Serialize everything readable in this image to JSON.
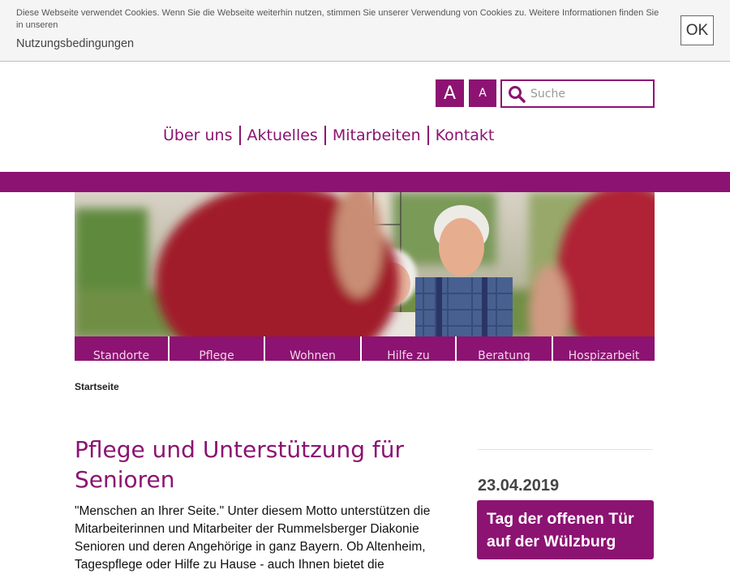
{
  "cookie_bar": {
    "text": "Diese Webseite verwendet Cookies. Wenn Sie die Webseite weiterhin nutzen, stimmen Sie unserer Verwendung von Cookies zu. Weitere Informationen finden Sie in unseren",
    "link": "Nutzungsbedingungen",
    "ok_label": "OK"
  },
  "font_size": {
    "large_label": "A",
    "small_label": "A"
  },
  "search": {
    "placeholder": "Suche",
    "value": ""
  },
  "top_nav": [
    "Über uns",
    "Aktuelles",
    "Mitarbeiten",
    "Kontakt"
  ],
  "category_tabs": [
    "Standorte",
    "Pflege",
    "Wohnen",
    "Hilfe zu",
    "Beratung",
    "Hospizarbeit"
  ],
  "breadcrumb": "Startseite",
  "main": {
    "title": "Pflege und Unterstützung für Senioren",
    "intro": "\"Menschen an Ihrer Seite.\" Unter diesem Motto unterstützen die Mitarbeiterinnen und Mitarbeiter der Rummelsberger Diakonie Senioren und deren Angehörige in ganz Bayern. Ob Altenheim, Tagespflege oder Hilfe zu Hause - auch Ihnen bietet die"
  },
  "sidebar": {
    "event_date": "23.04.2019",
    "event_title": "Tag der offenen Tür auf der Wülzburg"
  },
  "colors": {
    "brand": "#8c1372",
    "brand_text_light": "#f3d3ea",
    "cookie_bg": "#f5f5f5"
  }
}
